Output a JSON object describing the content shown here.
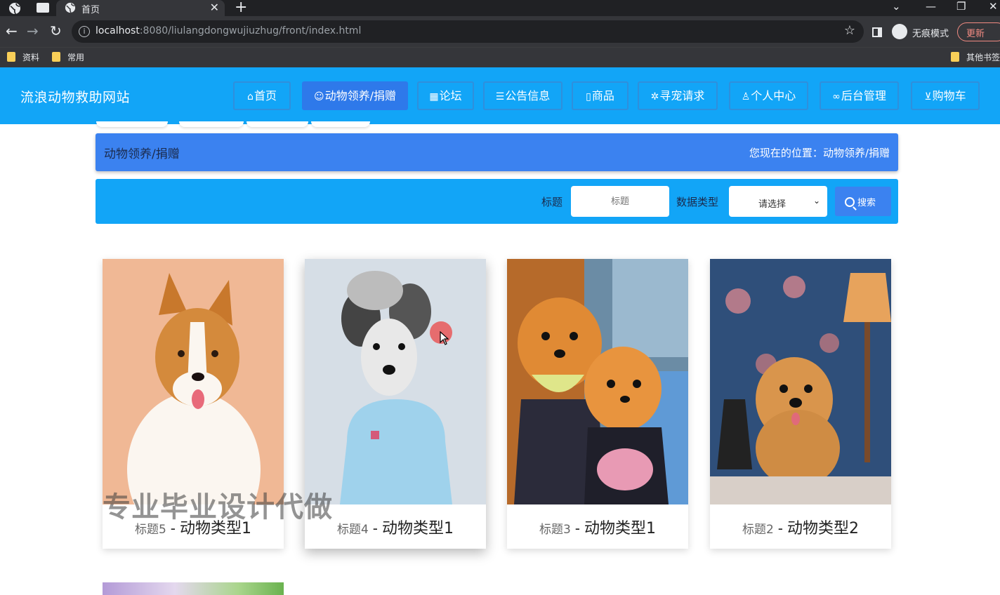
{
  "browser": {
    "tab_title": "首页",
    "url_host": "localhost",
    "url_rest": ":8080/liulangdongwujiuzhug/front/index.html",
    "incognito_label": "无痕模式",
    "update_label": "更新",
    "bookmarks": [
      "资料",
      "常用",
      "其他书签"
    ]
  },
  "header": {
    "site_title": "流浪动物救助网站",
    "nav": [
      {
        "icon": "home-icon",
        "label": "首页"
      },
      {
        "icon": "paw-icon",
        "label": "动物领养/捐赠"
      },
      {
        "icon": "forum-icon",
        "label": "论坛"
      },
      {
        "icon": "layers-icon",
        "label": "公告信息"
      },
      {
        "icon": "tag-icon",
        "label": "商品"
      },
      {
        "icon": "settings-icon",
        "label": "寻宠请求"
      },
      {
        "icon": "user-icon",
        "label": "个人中心"
      },
      {
        "icon": "link-icon",
        "label": "后台管理"
      },
      {
        "icon": "cart-icon",
        "label": "购物车"
      }
    ],
    "active_index": 1,
    "accent": "#12a5f7"
  },
  "breadcrumb": {
    "title": "动物领养/捐赠",
    "position_label": "您现在的位置：",
    "position_value": "动物领养/捐赠"
  },
  "search": {
    "title_label": "标题",
    "title_placeholder": "标题",
    "type_label": "数据类型",
    "type_selected": "请选择",
    "button_label": "搜索"
  },
  "cards": [
    {
      "title": "标题5",
      "type": "动物类型1"
    },
    {
      "title": "标题4",
      "type": "动物类型1"
    },
    {
      "title": "标题3",
      "type": "动物类型1"
    },
    {
      "title": "标题2",
      "type": "动物类型2"
    }
  ],
  "watermark": "专业毕业设计代做"
}
